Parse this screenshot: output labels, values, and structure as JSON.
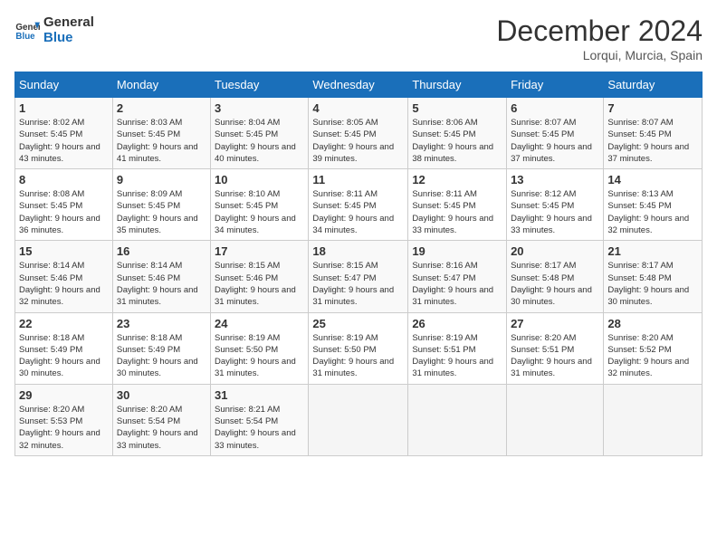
{
  "header": {
    "logo_general": "General",
    "logo_blue": "Blue",
    "month_title": "December 2024",
    "location": "Lorqui, Murcia, Spain"
  },
  "columns": [
    "Sunday",
    "Monday",
    "Tuesday",
    "Wednesday",
    "Thursday",
    "Friday",
    "Saturday"
  ],
  "weeks": [
    [
      {
        "day": "1",
        "sunrise": "Sunrise: 8:02 AM",
        "sunset": "Sunset: 5:45 PM",
        "daylight": "Daylight: 9 hours and 43 minutes."
      },
      {
        "day": "2",
        "sunrise": "Sunrise: 8:03 AM",
        "sunset": "Sunset: 5:45 PM",
        "daylight": "Daylight: 9 hours and 41 minutes."
      },
      {
        "day": "3",
        "sunrise": "Sunrise: 8:04 AM",
        "sunset": "Sunset: 5:45 PM",
        "daylight": "Daylight: 9 hours and 40 minutes."
      },
      {
        "day": "4",
        "sunrise": "Sunrise: 8:05 AM",
        "sunset": "Sunset: 5:45 PM",
        "daylight": "Daylight: 9 hours and 39 minutes."
      },
      {
        "day": "5",
        "sunrise": "Sunrise: 8:06 AM",
        "sunset": "Sunset: 5:45 PM",
        "daylight": "Daylight: 9 hours and 38 minutes."
      },
      {
        "day": "6",
        "sunrise": "Sunrise: 8:07 AM",
        "sunset": "Sunset: 5:45 PM",
        "daylight": "Daylight: 9 hours and 37 minutes."
      },
      {
        "day": "7",
        "sunrise": "Sunrise: 8:07 AM",
        "sunset": "Sunset: 5:45 PM",
        "daylight": "Daylight: 9 hours and 37 minutes."
      }
    ],
    [
      {
        "day": "8",
        "sunrise": "Sunrise: 8:08 AM",
        "sunset": "Sunset: 5:45 PM",
        "daylight": "Daylight: 9 hours and 36 minutes."
      },
      {
        "day": "9",
        "sunrise": "Sunrise: 8:09 AM",
        "sunset": "Sunset: 5:45 PM",
        "daylight": "Daylight: 9 hours and 35 minutes."
      },
      {
        "day": "10",
        "sunrise": "Sunrise: 8:10 AM",
        "sunset": "Sunset: 5:45 PM",
        "daylight": "Daylight: 9 hours and 34 minutes."
      },
      {
        "day": "11",
        "sunrise": "Sunrise: 8:11 AM",
        "sunset": "Sunset: 5:45 PM",
        "daylight": "Daylight: 9 hours and 34 minutes."
      },
      {
        "day": "12",
        "sunrise": "Sunrise: 8:11 AM",
        "sunset": "Sunset: 5:45 PM",
        "daylight": "Daylight: 9 hours and 33 minutes."
      },
      {
        "day": "13",
        "sunrise": "Sunrise: 8:12 AM",
        "sunset": "Sunset: 5:45 PM",
        "daylight": "Daylight: 9 hours and 33 minutes."
      },
      {
        "day": "14",
        "sunrise": "Sunrise: 8:13 AM",
        "sunset": "Sunset: 5:45 PM",
        "daylight": "Daylight: 9 hours and 32 minutes."
      }
    ],
    [
      {
        "day": "15",
        "sunrise": "Sunrise: 8:14 AM",
        "sunset": "Sunset: 5:46 PM",
        "daylight": "Daylight: 9 hours and 32 minutes."
      },
      {
        "day": "16",
        "sunrise": "Sunrise: 8:14 AM",
        "sunset": "Sunset: 5:46 PM",
        "daylight": "Daylight: 9 hours and 31 minutes."
      },
      {
        "day": "17",
        "sunrise": "Sunrise: 8:15 AM",
        "sunset": "Sunset: 5:46 PM",
        "daylight": "Daylight: 9 hours and 31 minutes."
      },
      {
        "day": "18",
        "sunrise": "Sunrise: 8:15 AM",
        "sunset": "Sunset: 5:47 PM",
        "daylight": "Daylight: 9 hours and 31 minutes."
      },
      {
        "day": "19",
        "sunrise": "Sunrise: 8:16 AM",
        "sunset": "Sunset: 5:47 PM",
        "daylight": "Daylight: 9 hours and 31 minutes."
      },
      {
        "day": "20",
        "sunrise": "Sunrise: 8:17 AM",
        "sunset": "Sunset: 5:48 PM",
        "daylight": "Daylight: 9 hours and 30 minutes."
      },
      {
        "day": "21",
        "sunrise": "Sunrise: 8:17 AM",
        "sunset": "Sunset: 5:48 PM",
        "daylight": "Daylight: 9 hours and 30 minutes."
      }
    ],
    [
      {
        "day": "22",
        "sunrise": "Sunrise: 8:18 AM",
        "sunset": "Sunset: 5:49 PM",
        "daylight": "Daylight: 9 hours and 30 minutes."
      },
      {
        "day": "23",
        "sunrise": "Sunrise: 8:18 AM",
        "sunset": "Sunset: 5:49 PM",
        "daylight": "Daylight: 9 hours and 30 minutes."
      },
      {
        "day": "24",
        "sunrise": "Sunrise: 8:19 AM",
        "sunset": "Sunset: 5:50 PM",
        "daylight": "Daylight: 9 hours and 31 minutes."
      },
      {
        "day": "25",
        "sunrise": "Sunrise: 8:19 AM",
        "sunset": "Sunset: 5:50 PM",
        "daylight": "Daylight: 9 hours and 31 minutes."
      },
      {
        "day": "26",
        "sunrise": "Sunrise: 8:19 AM",
        "sunset": "Sunset: 5:51 PM",
        "daylight": "Daylight: 9 hours and 31 minutes."
      },
      {
        "day": "27",
        "sunrise": "Sunrise: 8:20 AM",
        "sunset": "Sunset: 5:51 PM",
        "daylight": "Daylight: 9 hours and 31 minutes."
      },
      {
        "day": "28",
        "sunrise": "Sunrise: 8:20 AM",
        "sunset": "Sunset: 5:52 PM",
        "daylight": "Daylight: 9 hours and 32 minutes."
      }
    ],
    [
      {
        "day": "29",
        "sunrise": "Sunrise: 8:20 AM",
        "sunset": "Sunset: 5:53 PM",
        "daylight": "Daylight: 9 hours and 32 minutes."
      },
      {
        "day": "30",
        "sunrise": "Sunrise: 8:20 AM",
        "sunset": "Sunset: 5:54 PM",
        "daylight": "Daylight: 9 hours and 33 minutes."
      },
      {
        "day": "31",
        "sunrise": "Sunrise: 8:21 AM",
        "sunset": "Sunset: 5:54 PM",
        "daylight": "Daylight: 9 hours and 33 minutes."
      },
      null,
      null,
      null,
      null
    ]
  ]
}
